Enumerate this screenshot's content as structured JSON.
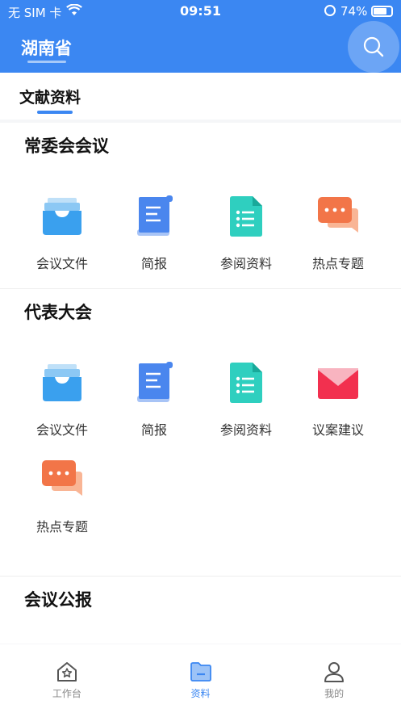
{
  "status_bar": {
    "carrier": "无 SIM 卡",
    "time": "09:51",
    "battery": "74%"
  },
  "header": {
    "title": "湖南省",
    "search_icon": "search-icon"
  },
  "tabs": [
    {
      "label": "文献资料",
      "active": true
    }
  ],
  "sections": [
    {
      "title": "常委会会议",
      "items": [
        {
          "label": "会议文件",
          "icon": "tray-icon"
        },
        {
          "label": "简报",
          "icon": "scroll-doc-icon"
        },
        {
          "label": "参阅资料",
          "icon": "list-doc-icon"
        },
        {
          "label": "热点专题",
          "icon": "chat-bubble-icon"
        }
      ]
    },
    {
      "title": "代表大会",
      "items": [
        {
          "label": "会议文件",
          "icon": "tray-icon"
        },
        {
          "label": "简报",
          "icon": "scroll-doc-icon"
        },
        {
          "label": "参阅资料",
          "icon": "list-doc-icon"
        },
        {
          "label": "议案建议",
          "icon": "envelope-icon"
        },
        {
          "label": "热点专题",
          "icon": "chat-bubble-icon"
        }
      ]
    },
    {
      "title": "会议公报",
      "items": []
    }
  ],
  "bottom_nav": [
    {
      "label": "工作台",
      "icon": "home-star-icon",
      "active": false
    },
    {
      "label": "资料",
      "icon": "folder-icon",
      "active": true
    },
    {
      "label": "我的",
      "icon": "person-icon",
      "active": false
    }
  ],
  "colors": {
    "primary": "#3b87f2",
    "teal": "#2fcfbf",
    "orange": "#f27548",
    "red": "#f2304f"
  }
}
